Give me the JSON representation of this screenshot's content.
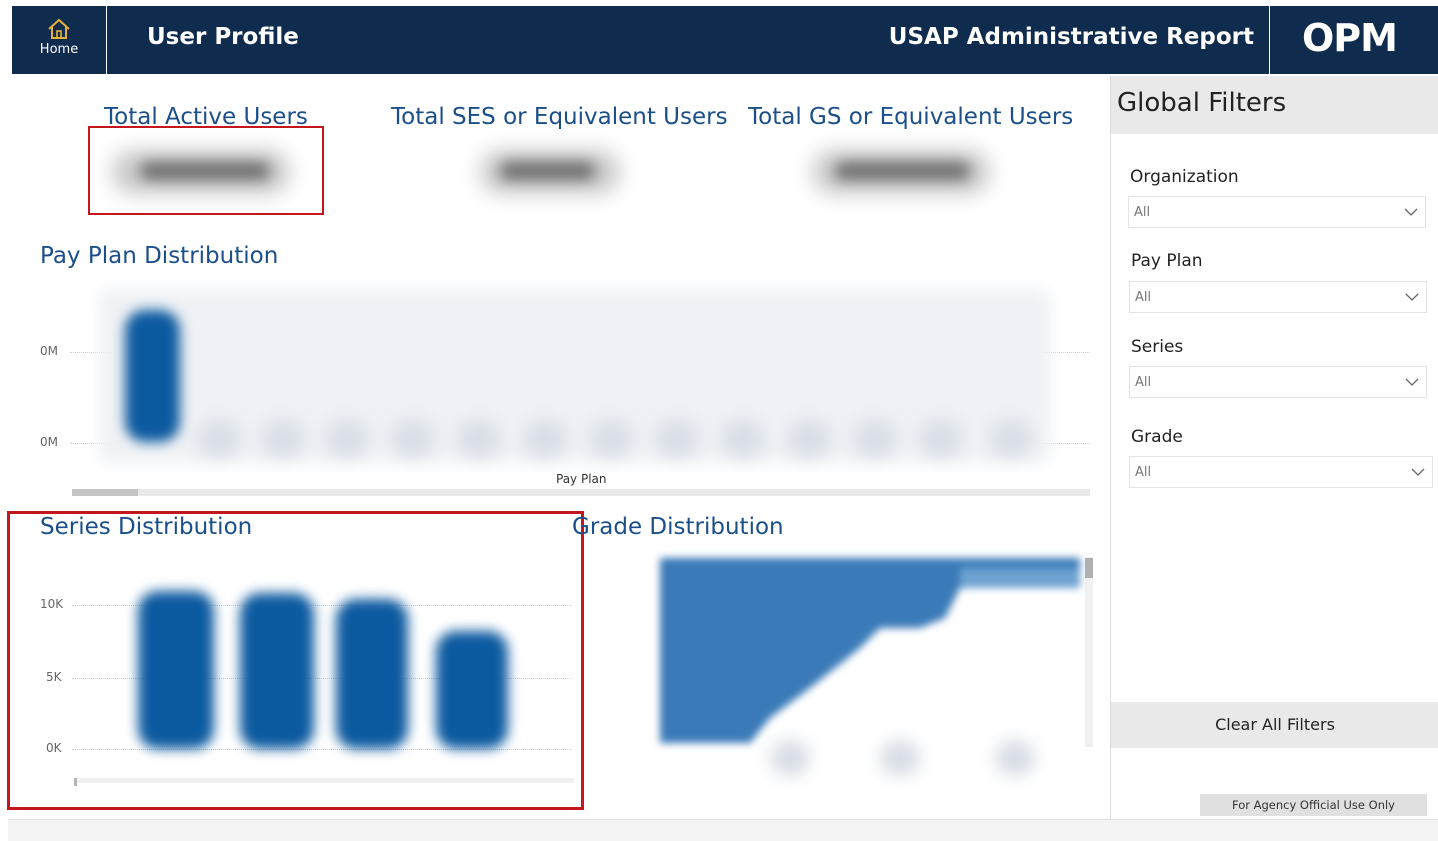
{
  "header": {
    "home_label": "Home",
    "title": "User Profile",
    "report_title": "USAP Administrative Report",
    "logo_text": "OPM",
    "background_color": "#0f2b4e"
  },
  "kpis": [
    {
      "title": "Total Active Users"
    },
    {
      "title": "Total SES or Equivalent Users"
    },
    {
      "title": "Total GS or Equivalent Users"
    }
  ],
  "pay_plan": {
    "title": "Pay Plan Distribution",
    "xlabel": "Pay Plan",
    "y_ticks": [
      "0M",
      "0M"
    ]
  },
  "series_dist": {
    "title": "Series Distribution",
    "y_ticks": [
      "10K",
      "5K",
      "0K"
    ]
  },
  "grade_dist": {
    "title": "Grade Distribution"
  },
  "chart_data": [
    {
      "type": "bar",
      "title": "Pay Plan Distribution",
      "xlabel": "Pay Plan",
      "ylabel": "",
      "y_tick_labels": [
        "0M",
        "0M"
      ],
      "categories": [],
      "values": []
    },
    {
      "type": "bar",
      "title": "Series Distribution",
      "xlabel": "",
      "ylabel": "",
      "y_tick_labels": [
        "10K",
        "5K",
        "0K"
      ],
      "ylim": [
        0,
        12000
      ],
      "categories": [],
      "values": [
        11000,
        10800,
        10400,
        8200
      ]
    },
    {
      "type": "area",
      "title": "Grade Distribution",
      "xlabel": "",
      "ylabel": ""
    }
  ],
  "filters": {
    "title": "Global Filters",
    "items": [
      {
        "label": "Organization",
        "value": "All"
      },
      {
        "label": "Pay Plan",
        "value": "All"
      },
      {
        "label": "Series",
        "value": "All"
      },
      {
        "label": "Grade",
        "value": "All"
      }
    ],
    "clear_label": "Clear All Filters",
    "footnote": "For Agency Official Use Only"
  },
  "colors": {
    "accent": "#1b4f8a",
    "bar": "#0c5aa0",
    "highlight": "#c4161c"
  }
}
